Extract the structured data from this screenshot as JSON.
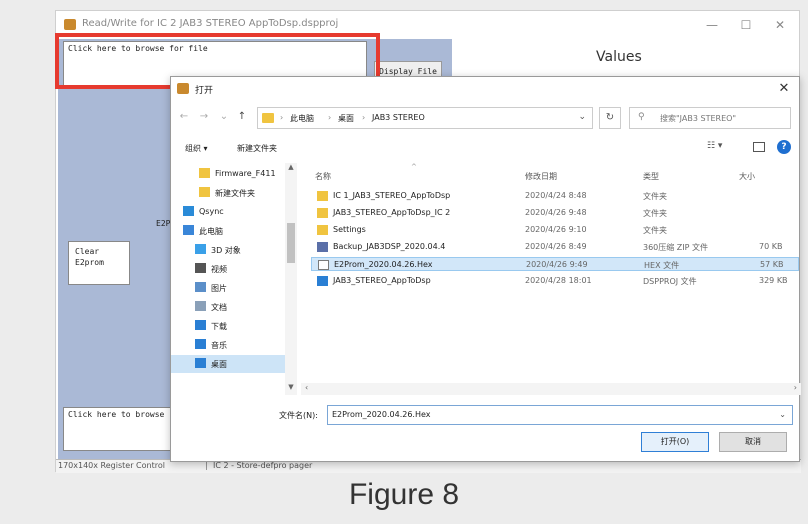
{
  "app": {
    "title": "Read/Write for IC 2 JAB3 STEREO AppToDsp.dspproj",
    "minimize": "—",
    "maximize": "☐",
    "close": "✕",
    "browse_top": "Click here to browse for file",
    "display_file": "Display File",
    "values_title": "Values",
    "e2p_label": "E2P",
    "clear_line1": "Clear",
    "clear_line2": "E2prom",
    "browse_bottom": "Click here to browse",
    "status_left": "170x140x Register Control",
    "status_right": "IC 2 - Store-defpro  pager"
  },
  "dialog": {
    "title": "打开",
    "close": "✕",
    "nav": {
      "back": "←",
      "forward": "→",
      "dropdown": "⌄",
      "up": "↑"
    },
    "breadcrumbs": [
      "此电脑",
      "桌面",
      "JAB3 STEREO"
    ],
    "separator": "›",
    "search_placeholder": "搜索\"JAB3 STEREO\"",
    "toolbar": {
      "organize": "组织 ▾",
      "new_folder": "新建文件夹",
      "view": "☷ ▾",
      "help": "?"
    },
    "nav_items": [
      {
        "label": "Firmware_F411",
        "icon": "folder-icon",
        "color": "#f0c440"
      },
      {
        "label": "新建文件夹",
        "icon": "folder-icon",
        "color": "#f0c440"
      },
      {
        "label": "Qsync",
        "icon": "qsync-icon",
        "color": "#2a8bd8"
      },
      {
        "label": "此电脑",
        "icon": "computer-icon",
        "color": "#3a86d8"
      },
      {
        "label": "3D 对象",
        "icon": "3d-objects-icon",
        "color": "#3aa0e8"
      },
      {
        "label": "视频",
        "icon": "video-icon",
        "color": "#555555"
      },
      {
        "label": "图片",
        "icon": "pictures-icon",
        "color": "#5b8fc9"
      },
      {
        "label": "文档",
        "icon": "documents-icon",
        "color": "#8aa0b8"
      },
      {
        "label": "下载",
        "icon": "download-icon",
        "color": "#2a7fd4"
      },
      {
        "label": "音乐",
        "icon": "music-icon",
        "color": "#2a7fd4"
      },
      {
        "label": "桌面",
        "icon": "desktop-icon",
        "color": "#2a7fd4"
      }
    ],
    "columns": [
      "名称",
      "修改日期",
      "类型",
      "大小"
    ],
    "files": [
      {
        "name": "IC 1_JAB3_STEREO_AppToDsp",
        "date": "2020/4/24 8:48",
        "type": "文件夹",
        "size": "",
        "icon": "folder-icon",
        "color": "#f0c440"
      },
      {
        "name": "JAB3_STEREO_AppToDsp_IC 2",
        "date": "2020/4/26 9:48",
        "type": "文件夹",
        "size": "",
        "icon": "folder-icon",
        "color": "#f0c440"
      },
      {
        "name": "Settings",
        "date": "2020/4/26 9:10",
        "type": "文件夹",
        "size": "",
        "icon": "folder-icon",
        "color": "#f0c440"
      },
      {
        "name": "Backup_JAB3DSP_2020.04.4",
        "date": "2020/4/26 8:49",
        "type": "360压缩 ZIP 文件",
        "size": "70 KB",
        "icon": "zip-icon",
        "color": "#5a6fa8"
      },
      {
        "name": "E2Prom_2020.04.26.Hex",
        "date": "2020/4/26 9:49",
        "type": "HEX 文件",
        "size": "57 KB",
        "icon": "file-icon",
        "color": "#ffffff"
      },
      {
        "name": "JAB3_STEREO_AppToDsp",
        "date": "2020/4/28 18:01",
        "type": "DSPPROJ 文件",
        "size": "329 KB",
        "icon": "play-icon",
        "color": "#2a7fd4"
      }
    ],
    "selected_file_index": 4,
    "filename_label": "文件名(N):",
    "filename_value": "E2Prom_2020.04.26.Hex",
    "open_button": "打开(O)",
    "cancel_button": "取消"
  },
  "caption": "Figure 8",
  "colors": {
    "highlight": "#e63a2f",
    "canvas": "#aab9d6",
    "selection": "#d2e7f9"
  }
}
